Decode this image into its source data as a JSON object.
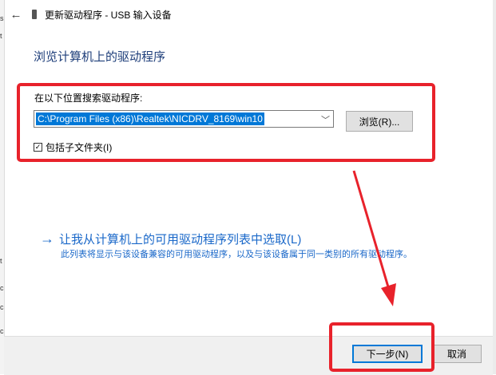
{
  "window": {
    "title": "更新驱动程序 - USB 输入设备",
    "back_icon": "back-arrow-icon",
    "device_icon": "usb-device-icon"
  },
  "page": {
    "heading": "浏览计算机上的驱动程序"
  },
  "search": {
    "label": "在以下位置搜索驱动程序:",
    "path_value": "C:\\Program Files (x86)\\Realtek\\NICDRV_8169\\win10",
    "browse_label": "浏览(R)..."
  },
  "include_subfolders": {
    "checked": true,
    "label": "包括子文件夹(I)"
  },
  "pick_from_list": {
    "link_text": "让我从计算机上的可用驱动程序列表中选取(L)",
    "description": "此列表将显示与该设备兼容的可用驱动程序，以及与该设备属于同一类别的所有驱动程序。"
  },
  "footer": {
    "next_label": "下一步(N)",
    "cancel_label": "取消"
  },
  "colors": {
    "annotation_red": "#e8222b",
    "selection_blue": "#0078d7",
    "link_blue": "#1a68c9"
  }
}
